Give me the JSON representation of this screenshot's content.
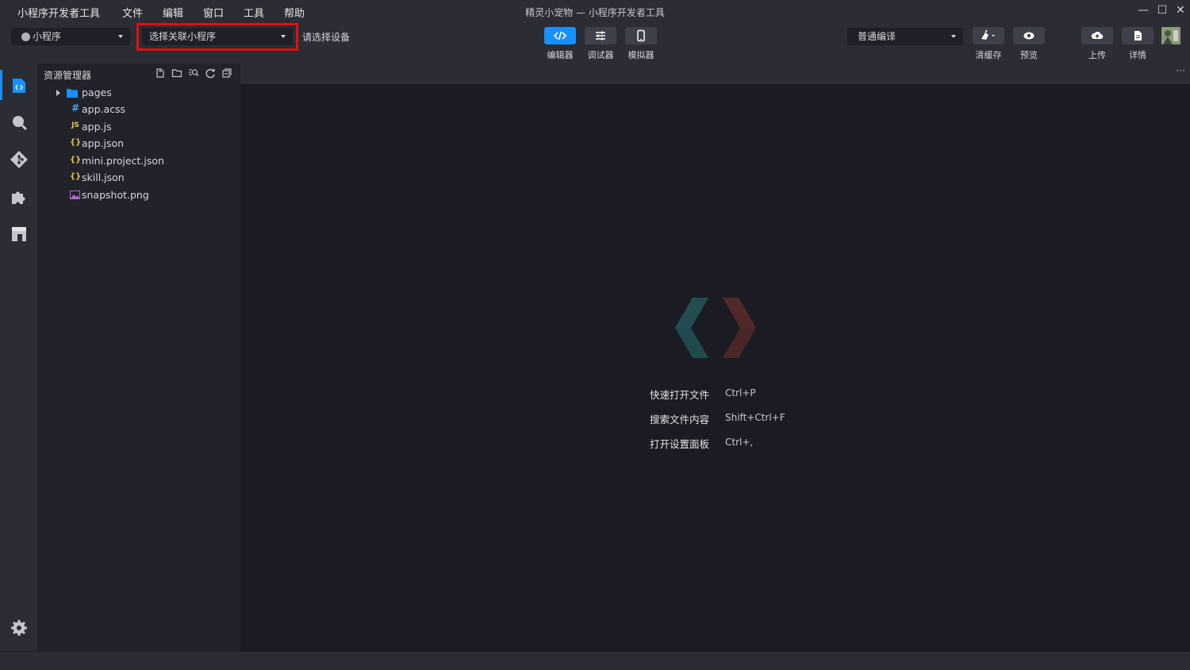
{
  "menu": {
    "items": [
      "小程序开发者工具",
      "文件",
      "编辑",
      "窗口",
      "工具",
      "帮助"
    ]
  },
  "window": {
    "title": "精灵小宠物 — 小程序开发者工具",
    "minimize": "—",
    "maximize": "☐",
    "close": "✕"
  },
  "toolbar": {
    "project_type": "小程序",
    "associate_select": "选择关联小程序",
    "device_text": "请选择设备",
    "editor_label": "编辑器",
    "debugger_label": "调试器",
    "simulator_label": "模拟器",
    "compile_mode": "普通编译",
    "clear_cache_label": "清缓存",
    "preview_label": "预览",
    "upload_label": "上传",
    "details_label": "详情",
    "accent_color": "#1890ff",
    "highlight_color": "#e01010"
  },
  "explorer": {
    "title": "资源管理器",
    "items": [
      {
        "name": "pages",
        "icon": "folder-icon",
        "glyph": "",
        "color": "#1890ff"
      },
      {
        "name": "app.acss",
        "icon": "css-icon",
        "glyph": "#",
        "color": "#4b9ff2"
      },
      {
        "name": "app.js",
        "icon": "js-icon",
        "glyph": "JS",
        "color": "#e8c547"
      },
      {
        "name": "app.json",
        "icon": "json-icon",
        "glyph": "{}",
        "color": "#e8c547"
      },
      {
        "name": "mini.project.json",
        "icon": "json-icon",
        "glyph": "{}",
        "color": "#e8c547"
      },
      {
        "name": "skill.json",
        "icon": "json-icon",
        "glyph": "{}",
        "color": "#e8c547"
      },
      {
        "name": "snapshot.png",
        "icon": "image-icon",
        "glyph": "",
        "color": "#b264d6"
      }
    ]
  },
  "editor": {
    "more": "···",
    "shortcuts": [
      {
        "label": "快速打开文件",
        "key": "Ctrl+P"
      },
      {
        "label": "搜索文件内容",
        "key": "Shift+Ctrl+F"
      },
      {
        "label": "打开设置面板",
        "key": "Ctrl+,"
      }
    ]
  }
}
